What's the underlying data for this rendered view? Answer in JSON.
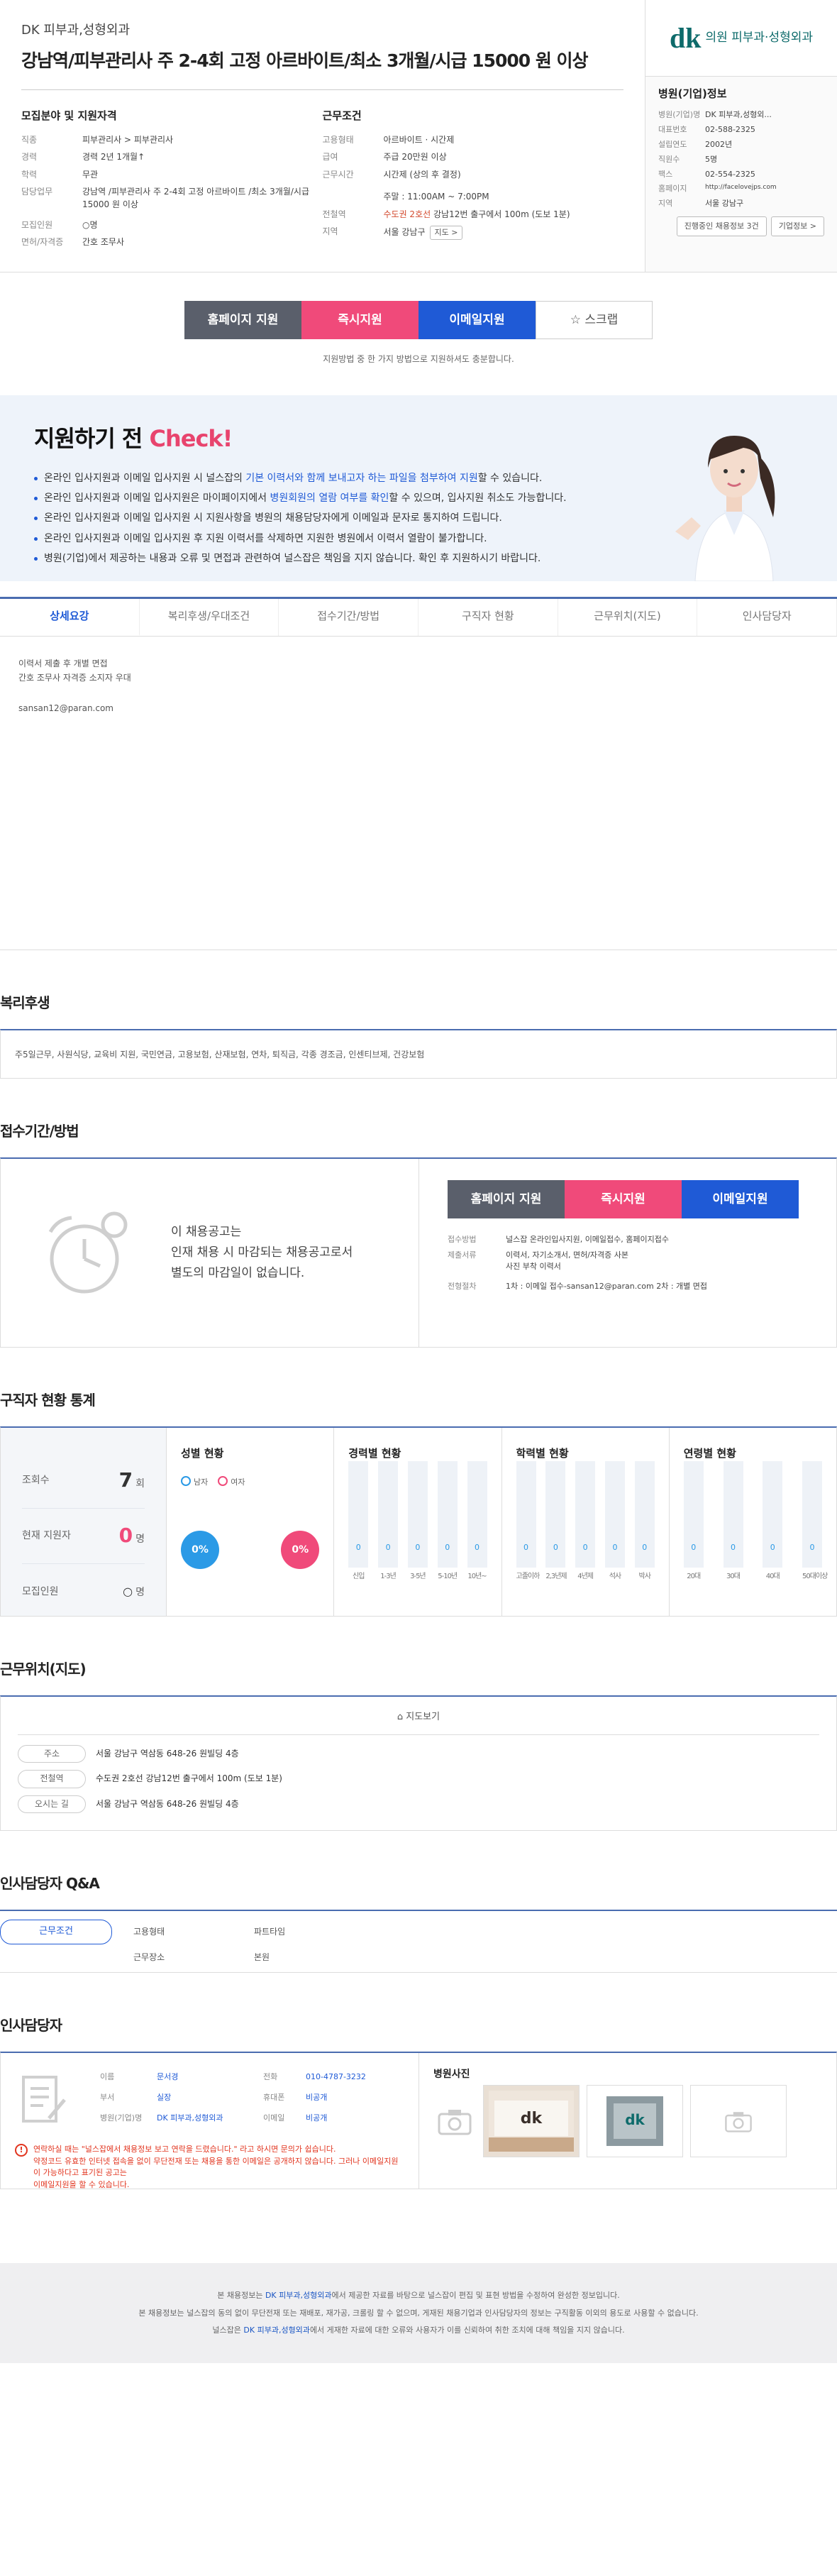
{
  "header": {
    "company": "DK 피부과,성형외과",
    "title": "강남역/피부관리사 주 2-4회 고정 아르바이트/최소 3개월/시급 15000 원 이상",
    "recruit": {
      "heading": "모집분야 및 지원자격",
      "rows": [
        {
          "k": "직종",
          "v": "피부관리사 > 피부관리사"
        },
        {
          "k": "경력",
          "v": "경력 2년 1개월↑"
        },
        {
          "k": "학력",
          "v": "무관"
        },
        {
          "k": "담당업무",
          "v": "강남역 /피부관리사 주 2-4회 고정 아르바이트 /최소 3개월/시급 15000 원 이상"
        },
        {
          "k": "모집인원",
          "v": "○명"
        },
        {
          "k": "면허/자격증",
          "v": "간호 조무사"
        }
      ]
    },
    "work": {
      "heading": "근무조건",
      "type_label": "고용형태",
      "type_value": "아르바이트 · 시간제",
      "pay_label": "급여",
      "pay_value": "주급 20만원 이상",
      "time_label": "근무시간",
      "time_value": "시간제 (상의 후 결정)",
      "week_value": "주말 : 11:00AM ~ 7:00PM",
      "subway_label": "전철역",
      "subway_line": "수도권 2호선",
      "subway_value": "강남12번 출구에서 100m (도보 1분)",
      "region_label": "지역",
      "region_value": "서울 강남구",
      "map_btn": "지도 >"
    }
  },
  "hospital": {
    "logo_mark": "dk",
    "logo_text": "의원 피부과·성형외과",
    "heading": "병원(기업)정보",
    "rows": [
      {
        "k": "병원(기업)명",
        "v": "DK 피부과,성형외..."
      },
      {
        "k": "대표번호",
        "v": "02-588-2325"
      },
      {
        "k": "설립연도",
        "v": "2002년"
      },
      {
        "k": "직원수",
        "v": "5명"
      },
      {
        "k": "팩스",
        "v": "02-554-2325"
      },
      {
        "k": "홈페이지",
        "v": "http://facelovejps.com"
      },
      {
        "k": "지역",
        "v": "서울 강남구"
      }
    ],
    "btn_more": "진행중인 채용정보 3건",
    "btn_info": "기업정보 >"
  },
  "apply": {
    "homepage": "홈페이지 지원",
    "instant": "즉시지원",
    "email": "이메일지원",
    "scrap": "☆ 스크랩",
    "note": "지원방법 중 한 가지 방법으로 지원하셔도 충분합니다."
  },
  "check": {
    "title_a": "지원하기 전 ",
    "title_b": "Check!",
    "items": [
      {
        "a": "온라인 입사지원과 이메일 입사지원 시 널스잡의 ",
        "hl": "기본 이력서와 함께 보내고자 하는 파일을 첨부하여 지원",
        "b": "할 수 있습니다."
      },
      {
        "a": "온라인 입사지원과 이메일 입사지원은 마이페이지에서 ",
        "hl": "병원회원의 열람 여부를 확인",
        "b": "할 수 있으며, 입사지원 취소도 가능합니다."
      },
      {
        "a": "온라인 입사지원과 이메일 입사지원 시 지원사항을 병원의 채용담당자에게 이메일과 문자로 통지하여 드립니다.",
        "hl": "",
        "b": ""
      },
      {
        "a": "온라인 입사지원과 이메일 입사지원 후 지원 이력서를 삭제하면 지원한 병원에서 이력서 열람이 불가합니다.",
        "hl": "",
        "b": ""
      },
      {
        "a": "병원(기업)에서 제공하는 내용과 오류 및 면접과 관련하여 널스잡은 책임을 지지 않습니다. 확인 후 지원하시기 바랍니다.",
        "hl": "",
        "b": ""
      }
    ]
  },
  "tabs": [
    "상세요강",
    "복리후생/우대조건",
    "접수기간/방법",
    "구직자 현황",
    "근무위치(지도)",
    "인사담당자"
  ],
  "detail": {
    "line1": "이력서 제출 후 개별 면접",
    "line2": "간호 조무사 자격증 소지자 우대",
    "email": "sansan12@paran.com"
  },
  "benefit": {
    "title": "복리후생",
    "text": "주5일근무, 사원식당, 교육비 지원, 국민연금, 고용보험, 산재보험, 연차, 퇴직금, 각종 경조금, 인센티브제, 건강보험"
  },
  "receipt": {
    "title": "접수기간/방법",
    "closed1": "이 채용공고는",
    "closed2": "인재 채용 시 마감되는 채용공고로서",
    "closed3": "별도의 마감일이 없습니다.",
    "rows": [
      {
        "k": "접수방법",
        "v": "널스잡 온라인입사지원, 이메일접수, 홈페이지접수"
      },
      {
        "k": "제출서류",
        "v": "이력서, 자기소개서, 면허/자격증 사본"
      },
      {
        "k": "",
        "v": "사진 부착 이력서"
      },
      {
        "k": "전형절차",
        "v": "1차 : 이메일 접수-sansan12@paran.com   2차 : 개별 면접"
      }
    ]
  },
  "stats": {
    "title": "구직자 현황 통계",
    "views_label": "조회수",
    "views": "7",
    "views_unit": "회",
    "applicants_label": "현재 지원자",
    "applicants": "0",
    "applicants_unit": "명",
    "recruit_label": "모집인원",
    "recruit": "○",
    "recruit_unit": "명",
    "gender_title": "성별 현황",
    "male": "남자",
    "female": "여자",
    "male_pct": "0%",
    "female_pct": "0%",
    "career_title": "경력별 현황",
    "edu_title": "학력별 현황",
    "age_title": "연령별 현황"
  },
  "chart_data": [
    {
      "type": "bar",
      "title": "경력별 현황",
      "categories": [
        "신입",
        "1-3년",
        "3-5년",
        "5-10년",
        "10년~"
      ],
      "values": [
        0,
        0,
        0,
        0,
        0
      ]
    },
    {
      "type": "bar",
      "title": "학력별 현황",
      "categories": [
        "고졸이하",
        "2,3년제",
        "4년제",
        "석사",
        "박사"
      ],
      "values": [
        0,
        0,
        0,
        0,
        0
      ]
    },
    {
      "type": "bar",
      "title": "연령별 현황",
      "categories": [
        "20대",
        "30대",
        "40대",
        "50대이상"
      ],
      "values": [
        0,
        0,
        0,
        0
      ]
    }
  ],
  "location": {
    "title": "근무위치(지도)",
    "map_link": "지도보기",
    "rows": [
      {
        "k": "주소",
        "v": "서울 강남구 역삼동 648-26 원빌딩 4층"
      },
      {
        "k": "전철역",
        "v": "수도권 2호선 강남12번 출구에서 100m (도보 1분)"
      },
      {
        "k": "오시는 길",
        "v": "서울 강남구 역삼동 648-26 원빌딩 4층"
      }
    ]
  },
  "qna": {
    "title": "인사담당자 Q&A",
    "btn": "근무조건",
    "r1": [
      "고용형태",
      "파트타임"
    ],
    "r2": [
      "근무장소",
      "본원"
    ]
  },
  "manager": {
    "title": "인사담당자",
    "rows": [
      {
        "k": "이름",
        "v": "문서경",
        "k2": "전화",
        "v2": "010-4787-3232"
      },
      {
        "k": "부서",
        "v": "실장",
        "k2": "휴대폰",
        "v2": "비공개"
      },
      {
        "k": "병원(기업)명",
        "v": "DK 피부과,성형외과",
        "k2": "이메일",
        "v2": "비공개"
      }
    ],
    "warn1": "연락하실 때는 \"널스잡에서 채용정보 보고 연락을 드렸습니다.\" 라고 하시면 문의가 쉽습니다.",
    "warn2": "약정코드 유효한 인터넷 접속을 없이 무단전재 또는 채용을 통한 이메일은 공개하지 않습니다. 그러나 이메일지원이 가능하다고 표기된 공고는",
    "warn3": "이메일지원을 할 수 있습니다.",
    "photo_title": "병원사진"
  },
  "footer": {
    "l1a": "본 채용정보는 ",
    "l1b": "DK 피부과,성형외과",
    "l1c": "에서 제공한 자료를 바탕으로 널스잡이 편집 및 표현 방법을 수정하여 완성한 정보입니다.",
    "l2": "본 채용정보는 널스잡의 동의 없이 무단전재 또는 재배포, 재가공, 크롤링 할 수 없으며, 게재된 채용기업과 인사담당자의 정보는 구직활동 이외의 용도로 사용할 수 없습니다.",
    "l3a": "널스잡은 ",
    "l3b": "DK 피부과,성형외과",
    "l3c": "에서 게재한 자료에 대한 오류와 사용자가 이를 신뢰하여 취한 조치에 대해 책임을 지지 않습니다."
  }
}
